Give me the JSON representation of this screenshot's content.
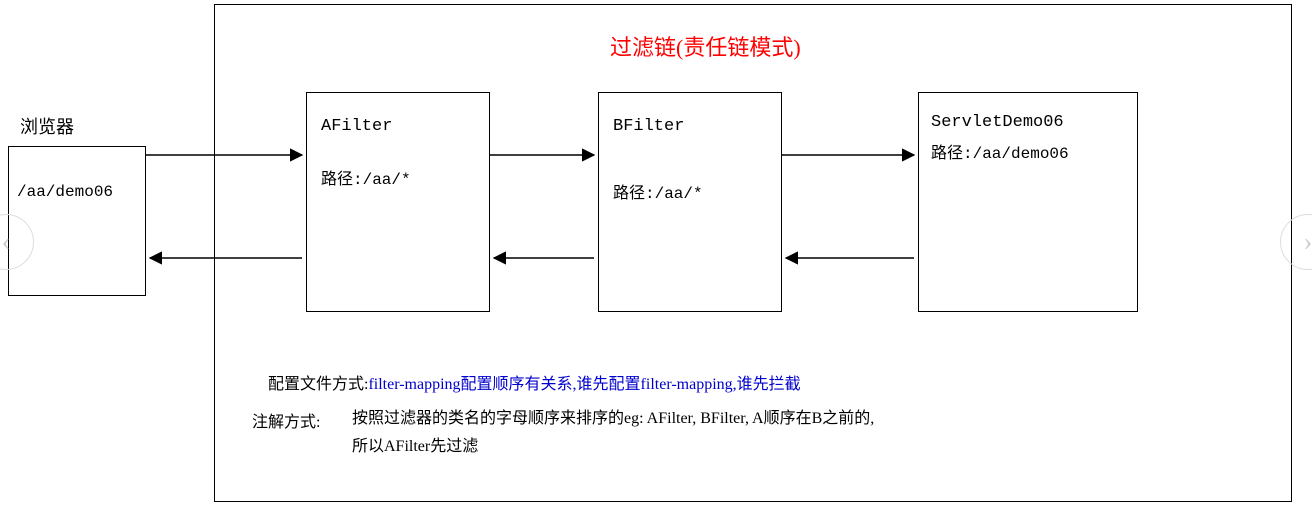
{
  "title": "过滤链(责任链模式)",
  "browser_label": "浏览器",
  "nodes": {
    "browser": {
      "name": "浏览器",
      "path": "/aa/demo06"
    },
    "afilter": {
      "name": "AFilter",
      "path_label": "路径:/aa/*"
    },
    "bfilter": {
      "name": "BFilter",
      "path_label": "路径:/aa/*"
    },
    "servlet": {
      "name": "ServletDemo06",
      "path_label": "路径:/aa/demo06"
    }
  },
  "notes": {
    "config_label": "配置文件方式:",
    "config_detail": "filter-mapping配置顺序有关系,谁先配置filter-mapping,谁先拦截",
    "anno_label": "注解方式:",
    "anno_line1": "按照过滤器的类名的字母顺序来排序的eg: AFilter, BFilter, A顺序在B之前的,",
    "anno_line2": "所以AFilter先过滤"
  },
  "nav": {
    "prev": "‹",
    "next": "›"
  }
}
